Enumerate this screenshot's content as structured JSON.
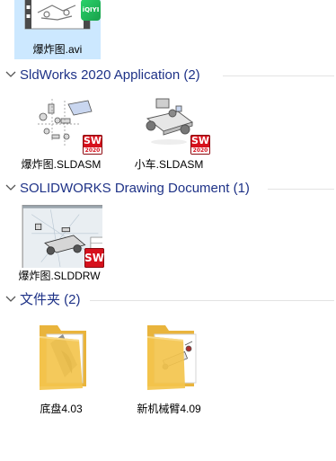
{
  "top_item": {
    "name": "爆炸图.avi",
    "badge_text": "iQIYI"
  },
  "groups": [
    {
      "title": "SldWorks 2020 Application (2)",
      "items": [
        {
          "name": "爆炸图.SLDASM",
          "badge": "SW",
          "badge_year": "2020"
        },
        {
          "name": "小车.SLDASM",
          "badge": "SW",
          "badge_year": "2020"
        }
      ]
    },
    {
      "title": "SOLIDWORKS Drawing Document (1)",
      "items": [
        {
          "name": "爆炸图.SLDDRW",
          "badge": "SW"
        }
      ]
    },
    {
      "title": "文件夹 (2)",
      "items": [
        {
          "name": "底盘4.03"
        },
        {
          "name": "新机械臂4.09"
        }
      ]
    }
  ],
  "colors": {
    "group_title": "#1e3287",
    "selection": "#cce8ff",
    "sw_red": "#d6111c",
    "folder_yellow": "#f3c44d"
  },
  "icons": {
    "chevron": "chevron-down-icon",
    "video": "video-file-icon",
    "assembly": "assembly-file-icon",
    "drawing": "drawing-file-icon",
    "folder": "folder-icon"
  }
}
